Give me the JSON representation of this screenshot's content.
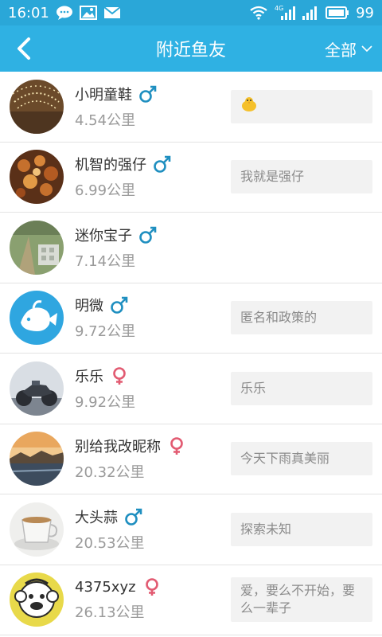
{
  "status_bar": {
    "time": "16:01",
    "network": "4G",
    "battery": "99",
    "left_icons": [
      "chat-bubble-icon",
      "image-icon",
      "mail-icon"
    ],
    "right_icons": [
      "wifi-icon",
      "signal-icon",
      "signal-icon",
      "battery-icon"
    ]
  },
  "header": {
    "title": "附近鱼友",
    "filter_label": "全部",
    "back_icon": "chevron-left-icon",
    "filter_icon": "chevron-down-icon"
  },
  "colors": {
    "header_bg": "#2fb1e3",
    "male": "#1f8fc0",
    "female": "#e25b72"
  },
  "users": [
    {
      "name": "小明童鞋",
      "gender": "male",
      "distance": "4.54公里",
      "signature": "",
      "signature_emoji": "chick-emoji",
      "avatar": "photo-lights"
    },
    {
      "name": "机智的强仔",
      "gender": "male",
      "distance": "6.99公里",
      "signature": "我就是强仔",
      "avatar": "photo-food"
    },
    {
      "name": "迷你宝子",
      "gender": "male",
      "distance": "7.14公里",
      "signature": "",
      "avatar": "photo-field"
    },
    {
      "name": "明微",
      "gender": "male",
      "distance": "9.72公里",
      "signature": "匿名和政策的",
      "avatar": "fish-logo"
    },
    {
      "name": "乐乐",
      "gender": "female",
      "distance": "9.92公里",
      "signature": "乐乐",
      "avatar": "photo-motorcycle"
    },
    {
      "name": "别给我改昵称",
      "gender": "female",
      "distance": "20.32公里",
      "signature": "今天下雨真美丽",
      "avatar": "photo-sunset"
    },
    {
      "name": "大头蒜",
      "gender": "male",
      "distance": "20.53公里",
      "signature": "探索未知",
      "avatar": "photo-teacup"
    },
    {
      "name": "4375xyz",
      "gender": "female",
      "distance": "26.13公里",
      "signature": "爱，要么不开始，要么一辈子",
      "avatar": "cartoon-monkey"
    }
  ]
}
